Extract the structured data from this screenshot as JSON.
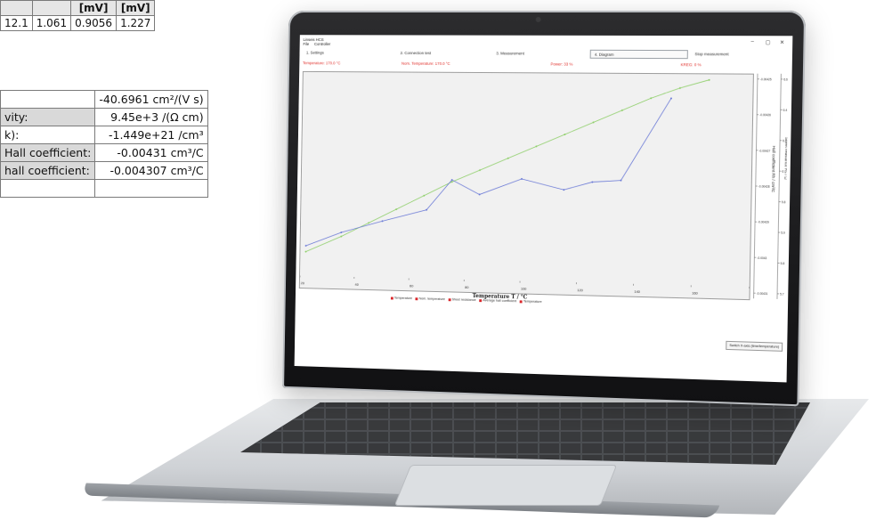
{
  "sheet": {
    "top_headers": [
      "",
      "",
      "[mV]",
      "[mV]"
    ],
    "top_row": [
      "12.1",
      "1.061",
      "0.9056",
      "1.227"
    ],
    "results": [
      {
        "label": "",
        "value": "-40.6961 cm²/(V s)"
      },
      {
        "label": "vity:",
        "value": "9.45e+3 /(Ω cm)"
      },
      {
        "label": "k):",
        "value": "-1.449e+21 /cm³"
      },
      {
        "label": "Hall coefficient:",
        "value": "-0.00431 cm³/C"
      },
      {
        "label": "hall coefficient:",
        "value": "-0.004307 cm³/C"
      },
      {
        "label": "",
        "value": ""
      }
    ]
  },
  "app": {
    "title": "Linseis HCS",
    "menu": [
      "File",
      "Controller"
    ],
    "tabs": [
      "1. Settings",
      "2. Connection test",
      "3. Measurement",
      "4. Diagram",
      "Stop measurement"
    ],
    "active_tab_index": 3,
    "status": {
      "temperature": "Temperature: 170.0 °C",
      "nom_temperature": "Nom. Temperature: 170.0 °C",
      "power": "Power: 33 %",
      "kreg": "KREG: 0 %"
    },
    "switch_button": "Switch X-axis (time/temperature)",
    "window_controls": [
      "–",
      "▢",
      "✕"
    ]
  },
  "chart_data": {
    "type": "line",
    "xlabel": "Temperature T / °C",
    "y2label": "Hall coefficient Rh / cm³/C",
    "y3label": "Sheet resistance Rs / Ω",
    "x_ticks": [
      20,
      40,
      60,
      80,
      100,
      120,
      140,
      160,
      180
    ],
    "xlim": [
      20,
      180
    ],
    "hall_ticks": [
      "-0.00425",
      "-0.00426",
      "-0.00427",
      "-0.00428",
      "-0.00429",
      "-0.0043",
      "-0.00431"
    ],
    "rs_ticks": [
      "6.6",
      "6.4",
      "6.2",
      "6",
      "5.8",
      "5.9",
      "5.8",
      "5.7"
    ],
    "series": [
      {
        "name": "Temperature",
        "color": "#8fcf6a",
        "x": [
          22,
          35,
          45,
          55,
          65,
          75,
          85,
          95,
          105,
          115,
          125,
          135,
          145,
          155,
          165
        ],
        "y": [
          0.12,
          0.2,
          0.27,
          0.34,
          0.41,
          0.48,
          0.54,
          0.6,
          0.66,
          0.72,
          0.78,
          0.84,
          0.9,
          0.95,
          0.99
        ]
      },
      {
        "name": "Average hall coefficient",
        "color": "#6a79d6",
        "x": [
          22,
          35,
          50,
          66,
          75,
          85,
          100,
          115,
          125,
          135,
          152
        ],
        "y": [
          0.15,
          0.22,
          0.28,
          0.34,
          0.49,
          0.42,
          0.5,
          0.45,
          0.49,
          0.5,
          0.9
        ]
      }
    ],
    "legend": [
      "Temperature",
      "Nom. temperature",
      "Sheet resistance",
      "Average hall coefficient",
      "Temperature"
    ],
    "legend_color": "#d9262a"
  }
}
